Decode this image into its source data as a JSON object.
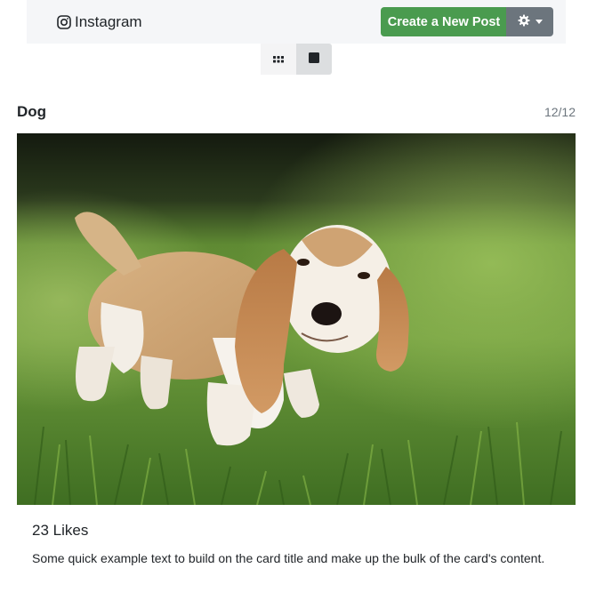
{
  "navbar": {
    "brand": {
      "icon": "instagram-icon",
      "label": "Instagram"
    },
    "create_button_label": "Create a New Post",
    "settings_icon": "gear-icon",
    "dropdown_icon": "caret-down-icon",
    "colors": {
      "create_button": "#4a9b4f",
      "settings_button": "#6c757d",
      "background": "#f5f6f8"
    }
  },
  "view_toggle": {
    "grid_icon": "grid-icon",
    "single_icon": "square-icon",
    "active": "single"
  },
  "post": {
    "title": "Dog",
    "counter": "12/12",
    "image_subject": "basset hound puppy on grass",
    "likes": "23 Likes",
    "text": "Some quick example text to build on the card title and make up the bulk of the card's content."
  }
}
